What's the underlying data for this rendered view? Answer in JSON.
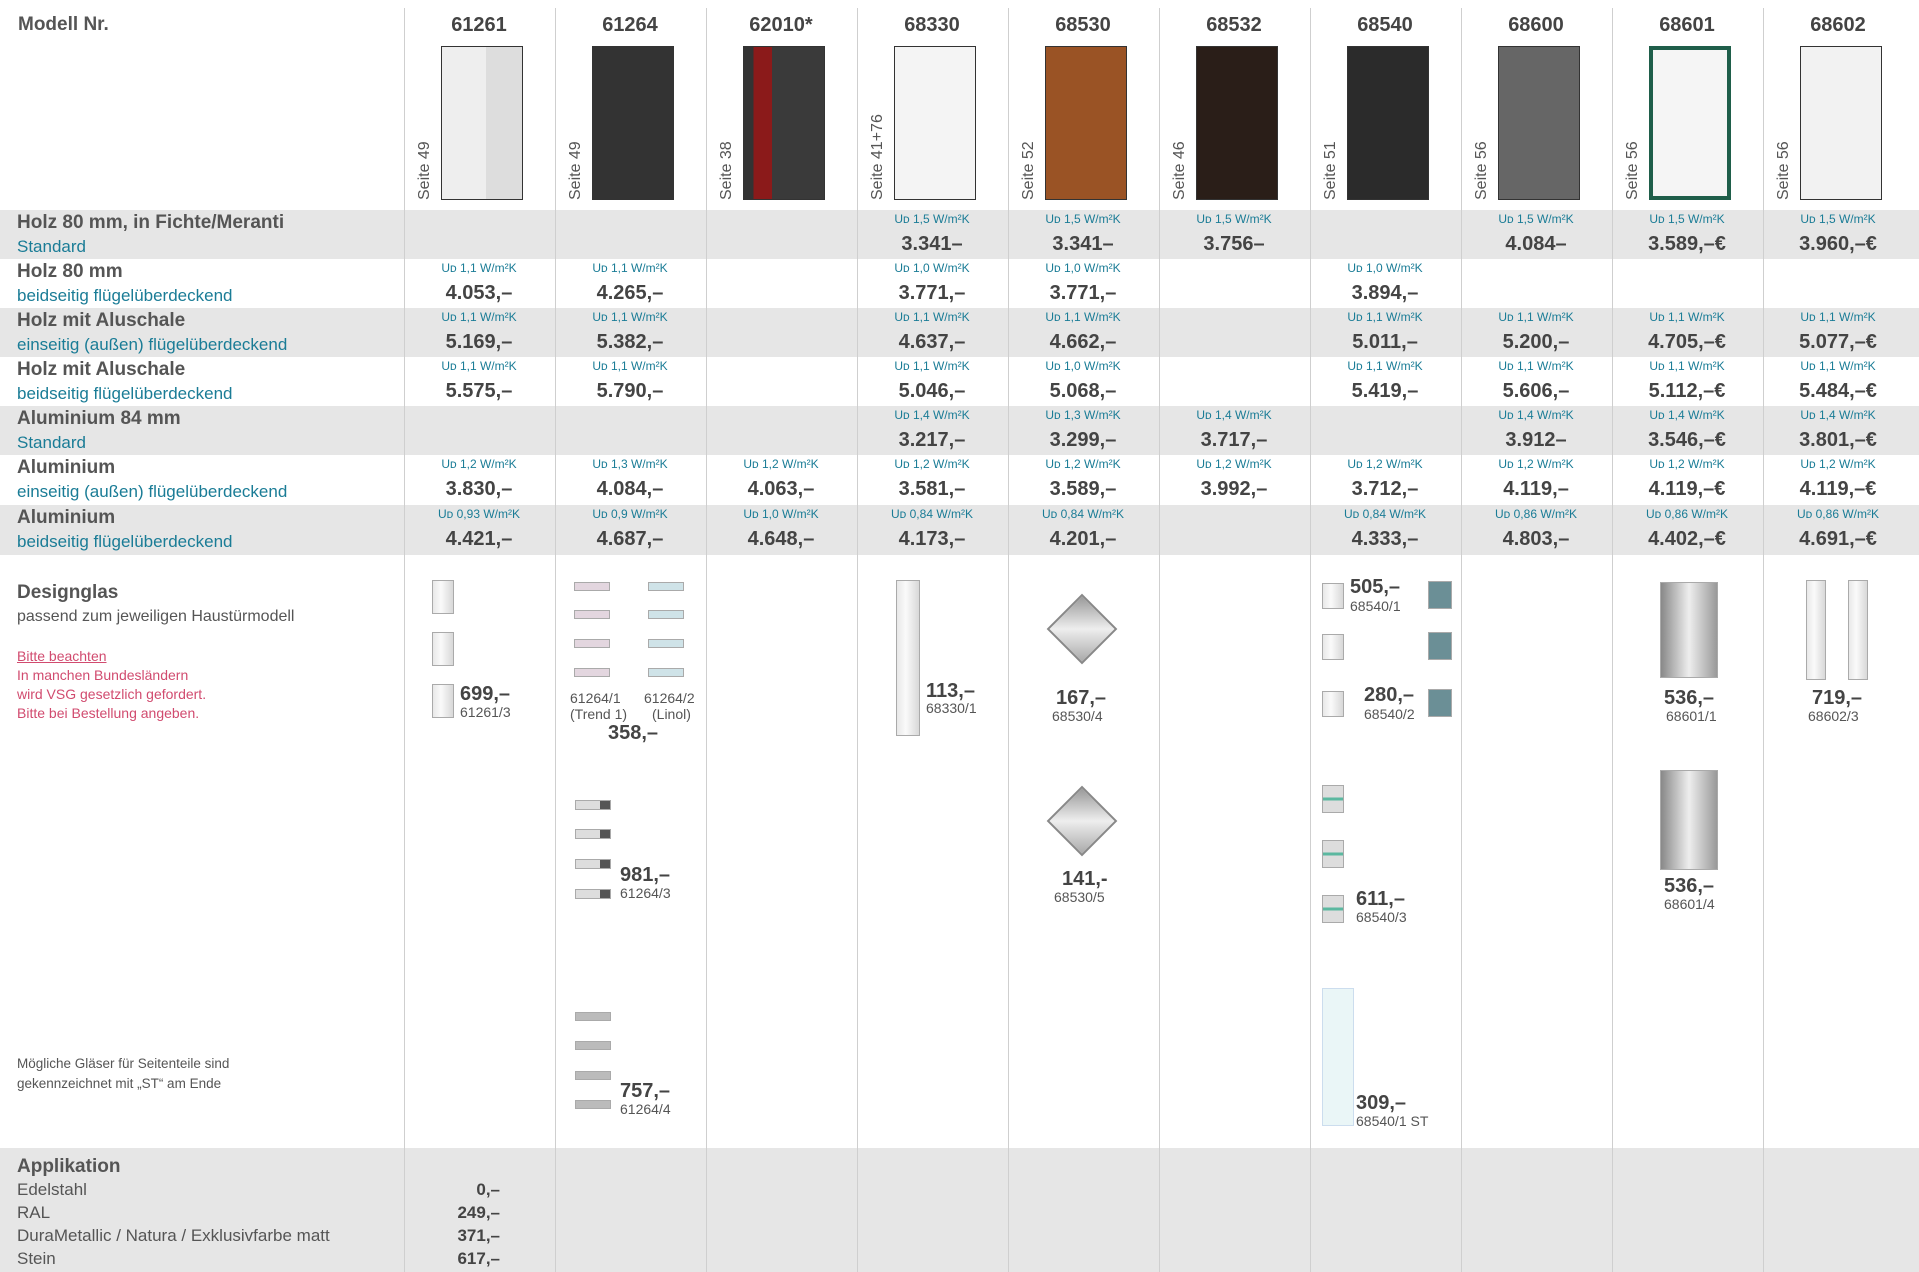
{
  "header": {
    "model_label": "Modell Nr."
  },
  "models": [
    {
      "nr": "61261",
      "seite": "Seite 49",
      "sup": ""
    },
    {
      "nr": "61264",
      "seite": "Seite 49",
      "sup": ""
    },
    {
      "nr": "62010",
      "seite": "Seite 38",
      "sup": "*"
    },
    {
      "nr": "68330",
      "seite": "Seite 41+76",
      "sup": ""
    },
    {
      "nr": "68530",
      "seite": "Seite 52",
      "sup": ""
    },
    {
      "nr": "68532",
      "seite": "Seite 46",
      "sup": ""
    },
    {
      "nr": "68540",
      "seite": "Seite 51",
      "sup": ""
    },
    {
      "nr": "68600",
      "seite": "Seite 56",
      "sup": ""
    },
    {
      "nr": "68601",
      "seite": "Seite 56",
      "sup": ""
    },
    {
      "nr": "68602",
      "seite": "Seite 56",
      "sup": ""
    }
  ],
  "rows": [
    {
      "title": "Holz 80 mm, in Fichte/Meranti",
      "sub": "Standard",
      "cells": [
        null,
        null,
        null,
        {
          "ud": "Uᴅ 1,5 W/m²K",
          "p": "3.341–"
        },
        {
          "ud": "Uᴅ 1,5 W/m²K",
          "p": "3.341–"
        },
        {
          "ud": "Uᴅ 1,5 W/m²K",
          "p": "3.756–"
        },
        null,
        {
          "ud": "Uᴅ 1,5 W/m²K",
          "p": "4.084–"
        },
        {
          "ud": "Uᴅ 1,5 W/m²K",
          "p": "3.589,–€"
        },
        {
          "ud": "Uᴅ 1,5 W/m²K",
          "p": "3.960,–€"
        }
      ]
    },
    {
      "title": "Holz 80 mm",
      "sub": "beidseitig flügelüberdeckend",
      "cells": [
        {
          "ud": "Uᴅ 1,1 W/m²K",
          "p": "4.053,–"
        },
        {
          "ud": "Uᴅ 1,1 W/m²K",
          "p": "4.265,–"
        },
        null,
        {
          "ud": "Uᴅ 1,0 W/m²K",
          "p": "3.771,–"
        },
        {
          "ud": "Uᴅ 1,0 W/m²K",
          "p": "3.771,–"
        },
        null,
        {
          "ud": "Uᴅ 1,0 W/m²K",
          "p": "3.894,–"
        },
        null,
        null,
        null
      ]
    },
    {
      "title": "Holz mit Aluschale",
      "sub": "einseitig (außen) flügelüberdeckend",
      "cells": [
        {
          "ud": "Uᴅ 1,1 W/m²K",
          "p": "5.169,–"
        },
        {
          "ud": "Uᴅ 1,1 W/m²K",
          "p": "5.382,–"
        },
        null,
        {
          "ud": "Uᴅ 1,1 W/m²K",
          "p": "4.637,–"
        },
        {
          "ud": "Uᴅ 1,1 W/m²K",
          "p": "4.662,–"
        },
        null,
        {
          "ud": "Uᴅ 1,1 W/m²K",
          "p": "5.011,–"
        },
        {
          "ud": "Uᴅ 1,1 W/m²K",
          "p": "5.200,–"
        },
        {
          "ud": "Uᴅ 1,1 W/m²K",
          "p": "4.705,–€"
        },
        {
          "ud": "Uᴅ 1,1 W/m²K",
          "p": "5.077,–€"
        }
      ]
    },
    {
      "title": "Holz mit Aluschale",
      "sub": "beidseitig flügelüberdeckend",
      "cells": [
        {
          "ud": "Uᴅ 1,1 W/m²K",
          "p": "5.575,–"
        },
        {
          "ud": "Uᴅ 1,1 W/m²K",
          "p": "5.790,–"
        },
        null,
        {
          "ud": "Uᴅ 1,1 W/m²K",
          "p": "5.046,–"
        },
        {
          "ud": "Uᴅ 1,0 W/m²K",
          "p": "5.068,–"
        },
        null,
        {
          "ud": "Uᴅ 1,1 W/m²K",
          "p": "5.419,–"
        },
        {
          "ud": "Uᴅ 1,1 W/m²K",
          "p": "5.606,–"
        },
        {
          "ud": "Uᴅ 1,1 W/m²K",
          "p": "5.112,–€"
        },
        {
          "ud": "Uᴅ 1,1 W/m²K",
          "p": "5.484,–€"
        }
      ]
    },
    {
      "title": "Aluminium 84 mm",
      "sub": "Standard",
      "cells": [
        null,
        null,
        null,
        {
          "ud": "Uᴅ 1,4 W/m²K",
          "p": "3.217,–"
        },
        {
          "ud": "Uᴅ 1,3 W/m²K",
          "p": "3.299,–"
        },
        {
          "ud": "Uᴅ 1,4 W/m²K",
          "p": "3.717,–"
        },
        null,
        {
          "ud": "Uᴅ 1,4 W/m²K",
          "p": "3.912–"
        },
        {
          "ud": "Uᴅ 1,4 W/m²K",
          "p": "3.546,–€"
        },
        {
          "ud": "Uᴅ 1,4 W/m²K",
          "p": "3.801,–€"
        }
      ]
    },
    {
      "title": "Aluminium",
      "sub": "einseitig (außen) flügelüberdeckend",
      "cells": [
        {
          "ud": "Uᴅ 1,2 W/m²K",
          "p": "3.830,–"
        },
        {
          "ud": "Uᴅ 1,3 W/m²K",
          "p": "4.084,–"
        },
        {
          "ud": "Uᴅ 1,2 W/m²K",
          "p": "4.063,–"
        },
        {
          "ud": "Uᴅ 1,2 W/m²K",
          "p": "3.581,–"
        },
        {
          "ud": "Uᴅ 1,2 W/m²K",
          "p": "3.589,–"
        },
        {
          "ud": "Uᴅ 1,2 W/m²K",
          "p": "3.992,–"
        },
        {
          "ud": "Uᴅ 1,2 W/m²K",
          "p": "3.712,–"
        },
        {
          "ud": "Uᴅ 1,2 W/m²K",
          "p": "4.119,–"
        },
        {
          "ud": "Uᴅ 1,2 W/m²K",
          "p": "4.119,–€"
        },
        {
          "ud": "Uᴅ 1,2 W/m²K",
          "p": "4.119,–€"
        }
      ]
    },
    {
      "title": "Aluminium",
      "sub": "beidseitig flügelüberdeckend",
      "cells": [
        {
          "ud": "Uᴅ 0,93 W/m²K",
          "p": "4.421,–"
        },
        {
          "ud": "Uᴅ 0,9 W/m²K",
          "p": "4.687,–"
        },
        {
          "ud": "Uᴅ 1,0 W/m²K",
          "p": "4.648,–"
        },
        {
          "ud": "Uᴅ 0,84 W/m²K",
          "p": "4.173,–"
        },
        {
          "ud": "Uᴅ 0,84 W/m²K",
          "p": "4.201,–"
        },
        null,
        {
          "ud": "Uᴅ 0,84 W/m²K",
          "p": "4.333,–"
        },
        {
          "ud": "Uᴅ 0,86 W/m²K",
          "p": "4.803,–"
        },
        {
          "ud": "Uᴅ 0,86 W/m²K",
          "p": "4.402,–€"
        },
        {
          "ud": "Uᴅ 0,86 W/m²K",
          "p": "4.691,–€"
        }
      ]
    }
  ],
  "designglas": {
    "title": "Designglas",
    "sub": "passend zum jeweiligen Haustürmodell",
    "note_link": "Bitte beachten",
    "note_lines": [
      "In manchen Bundesländern",
      "wird VSG gesetzlich gefordert.",
      "Bitte bei Bestellung angeben."
    ],
    "footnote": [
      "Mögliche Gläser für Seitenteile sind",
      "gekennzeichnet mit „ST“ am Ende"
    ],
    "items": {
      "g61261_3": {
        "price": "699,–",
        "code": "61261/3"
      },
      "g61264_1": {
        "code": "61264/1",
        "label": "(Trend 1)"
      },
      "g61264_2": {
        "code": "61264/2",
        "label": "(Linol)"
      },
      "g61264_12_price": "358,–",
      "g61264_3": {
        "price": "981,–",
        "code": "61264/3"
      },
      "g61264_4": {
        "price": "757,–",
        "code": "61264/4"
      },
      "g68330_1": {
        "price": "113,–",
        "code": "68330/1"
      },
      "g68530_4": {
        "price": "167,–",
        "code": "68530/4"
      },
      "g68530_5": {
        "price": "141,-",
        "code": "68530/5"
      },
      "g68540_1": {
        "price": "505,–",
        "code": "68540/1"
      },
      "g68540_2": {
        "price": "280,–",
        "code": "68540/2"
      },
      "g68540_3": {
        "price": "611,–",
        "code": "68540/3"
      },
      "g68540_1st": {
        "price": "309,–",
        "code": "68540/1 ST"
      },
      "g68601_1": {
        "price": "536,–",
        "code": "68601/1"
      },
      "g68601_4": {
        "price": "536,–",
        "code": "68601/4"
      },
      "g68602_3": {
        "price": "719,–",
        "code": "68602/3"
      }
    }
  },
  "applikation": {
    "title": "Applikation",
    "items": [
      {
        "label": "Edelstahl",
        "price": "0,–"
      },
      {
        "label": "RAL",
        "price": "249,–"
      },
      {
        "label": "DuraMetallic / Natura / Exklusivfarbe matt",
        "price": "371,–"
      },
      {
        "label": "Stein",
        "price": "617,–"
      }
    ]
  }
}
